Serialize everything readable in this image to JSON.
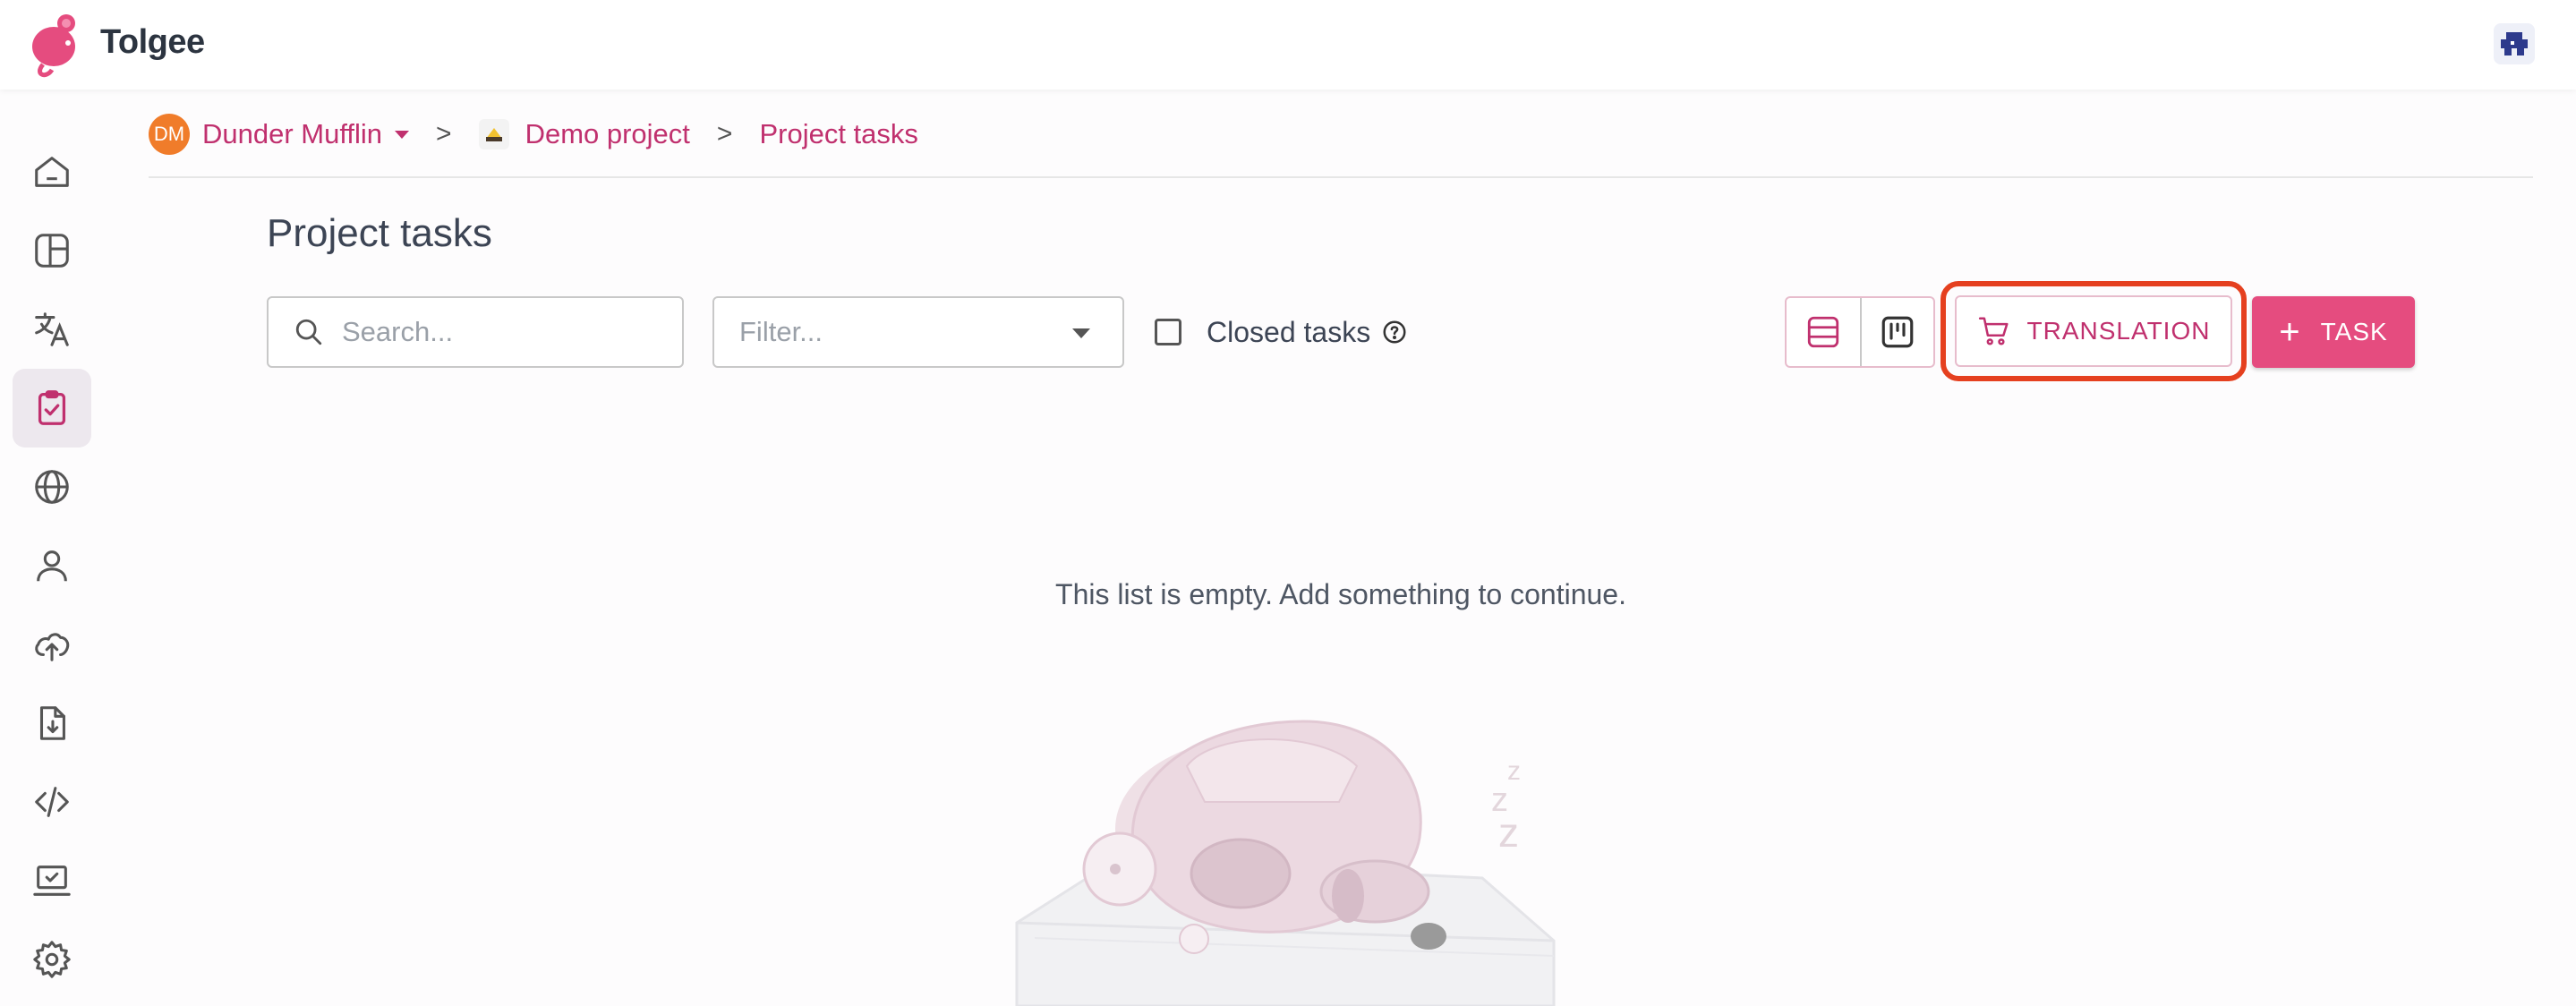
{
  "app": {
    "brand": "Tolgee"
  },
  "breadcrumb": {
    "org_initials": "DM",
    "org_name": "Dunder Mufflin",
    "project_name": "Demo project",
    "current": "Project tasks",
    "separator": ">"
  },
  "sidebar": {
    "items": [
      {
        "icon": "home-icon",
        "active": false
      },
      {
        "icon": "dashboard-icon",
        "active": false
      },
      {
        "icon": "translate-icon",
        "active": false
      },
      {
        "icon": "tasks-icon",
        "active": true
      },
      {
        "icon": "globe-icon",
        "active": false
      },
      {
        "icon": "user-icon",
        "active": false
      },
      {
        "icon": "upload-cloud-icon",
        "active": false
      },
      {
        "icon": "export-file-icon",
        "active": false
      },
      {
        "icon": "code-icon",
        "active": false
      },
      {
        "icon": "laptop-check-icon",
        "active": false
      },
      {
        "icon": "gear-icon",
        "active": false
      }
    ]
  },
  "page": {
    "title": "Project tasks",
    "search_placeholder": "Search...",
    "filter_placeholder": "Filter...",
    "closed_tasks_label": "Closed tasks",
    "translation_button": "TRANSLATION",
    "task_button": "TASK",
    "empty_message": "This list is empty. Add something to continue."
  },
  "colors": {
    "accent": "#c0306e",
    "primary_button": "#e54c7f",
    "highlight": "#e5401f",
    "org_avatar": "#f07c2a"
  }
}
